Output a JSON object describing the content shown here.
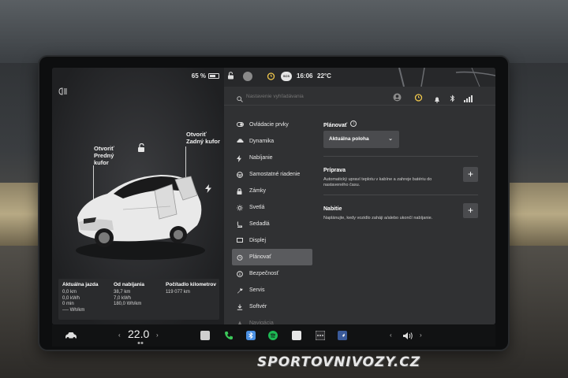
{
  "status_bar": {
    "battery_percent": "65 %",
    "battery_level": 0.65,
    "profile_icon": "person-icon",
    "alarm_icon": "alarm-clock-icon",
    "app_badge": "SCS",
    "time": "16:06",
    "outside_temp": "22°C"
  },
  "car_panel": {
    "frunk_label_1": "Otvoriť",
    "frunk_label_2": "Predný",
    "frunk_label_3": "kufor",
    "trunk_label_1": "Otvoriť",
    "trunk_label_2": "Zadný kufor"
  },
  "trip_stats": {
    "col1": {
      "title": "Aktuálna jazda",
      "values": [
        "0,0 km",
        "0,0 kWh",
        "0 min",
        "---- Wh/km"
      ]
    },
    "col2": {
      "title": "Od nabíjania",
      "values": [
        "38,7 km",
        "7,0 kWh",
        "180,0 Wh/km"
      ]
    },
    "col3": {
      "title": "Počítadlo kilometrov",
      "values": [
        "119 077 km"
      ]
    }
  },
  "search": {
    "placeholder": "Nastavenie vyhľadávania"
  },
  "nav": {
    "items": [
      {
        "label": "Ovládacie prvky",
        "icon": "toggle-icon"
      },
      {
        "label": "Dynamika",
        "icon": "car-icon"
      },
      {
        "label": "Nabíjanie",
        "icon": "bolt-icon"
      },
      {
        "label": "Samostatné riadenie",
        "icon": "steering-wheel-icon"
      },
      {
        "label": "Zámky",
        "icon": "lock-icon"
      },
      {
        "label": "Svetlá",
        "icon": "sun-icon"
      },
      {
        "label": "Sedadlá",
        "icon": "seat-icon"
      },
      {
        "label": "Displej",
        "icon": "display-icon"
      },
      {
        "label": "Plánovať",
        "icon": "alarm-clock-icon"
      },
      {
        "label": "Bezpečnosť",
        "icon": "info-icon"
      },
      {
        "label": "Servis",
        "icon": "wrench-icon"
      },
      {
        "label": "Softvér",
        "icon": "download-icon"
      },
      {
        "label": "Navigácia",
        "icon": "navigation-icon"
      }
    ],
    "active_index": 8
  },
  "content": {
    "title": "Plánovať",
    "location_dropdown": "Aktuálna poloha",
    "section1": {
      "title": "Príprava",
      "description": "Automatický upraví teplotu v kabíne a zahreje batériu do nastaveného času."
    },
    "section2": {
      "title": "Nabitie",
      "description": "Naplánujte, kedy vozidlo zaháji a/alebo ukončí nabíjanie."
    }
  },
  "dock": {
    "temperature": "22.0",
    "temp_left_arrow": "‹",
    "temp_right_arrow": "›",
    "volume_left_arrow": "‹",
    "volume_right_arrow": "›"
  },
  "colors": {
    "screen_bg": "#303133",
    "panel_bg": "#2a2b2d",
    "active_nav": "#5a5b5e",
    "phone_green": "#3cc85a",
    "bluetooth_blue": "#4a90e2",
    "spotify_green": "#1db954",
    "alarm_yellow": "#f2c94c"
  },
  "watermark": "SPORTOVNIVOZY.CZ"
}
